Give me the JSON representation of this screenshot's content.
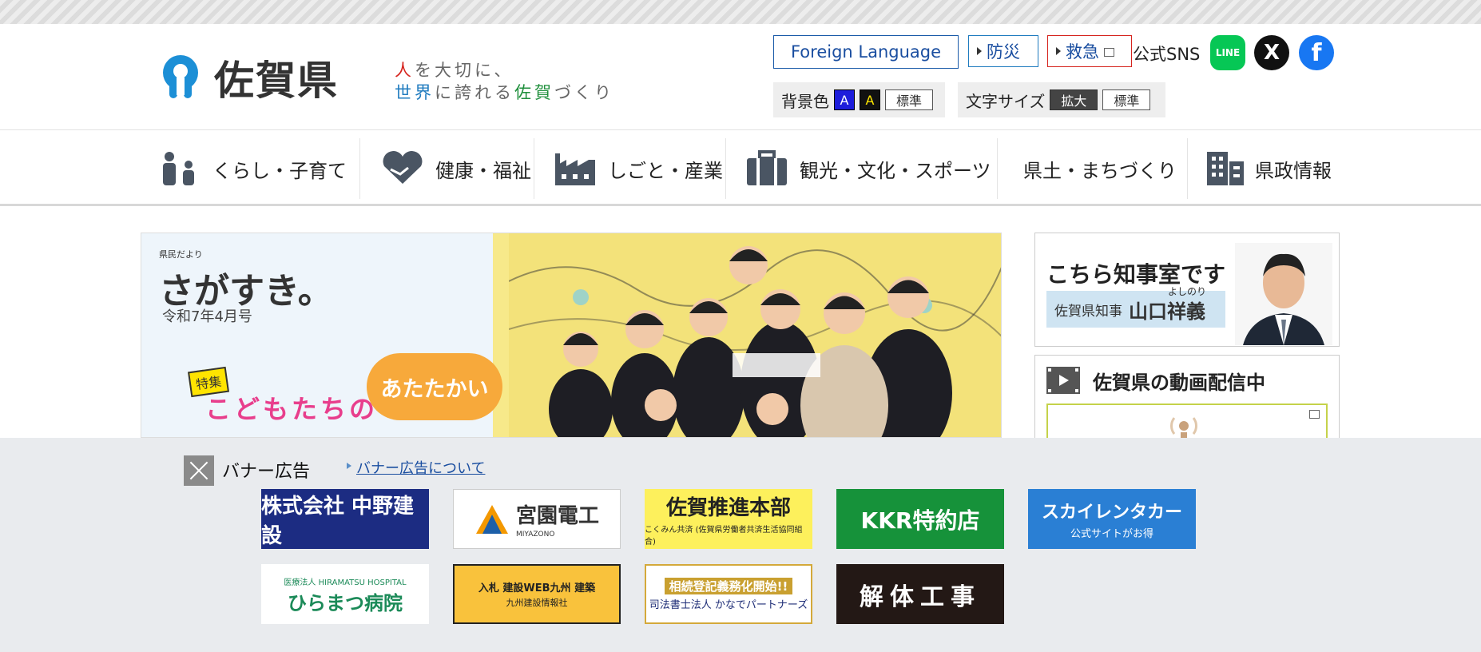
{
  "header": {
    "logo_text": "佐賀県",
    "slogan_line1_a": "人",
    "slogan_line1_b": "を大切に、",
    "slogan_line2_a": "世界",
    "slogan_line2_b": "に誇れる",
    "slogan_line2_c": "佐賀",
    "slogan_line2_d": "づくり",
    "foreign_language": "Foreign Language",
    "bousai": "防災",
    "kyukyu": "救急",
    "sns_label": "公式SNS",
    "sns_line": "LINE",
    "sns_x": "X",
    "sns_fb": "f",
    "bg_color_label": "背景色",
    "bg_blue": "A",
    "bg_black": "A",
    "bg_standard": "標準",
    "font_size_label": "文字サイズ",
    "font_enlarge": "拡大",
    "font_standard": "標準"
  },
  "nav": {
    "items": [
      {
        "label": "くらし・子育て",
        "icon": "family-icon"
      },
      {
        "label": "健康・福祉",
        "icon": "heart-hands-icon"
      },
      {
        "label": "しごと・産業",
        "icon": "factory-icon"
      },
      {
        "label": "観光・文化・スポーツ",
        "icon": "suitcase-icon"
      },
      {
        "label": "県土・まちづくり",
        "icon": ""
      },
      {
        "label": "県政情報",
        "icon": "building-icon"
      }
    ]
  },
  "hero": {
    "small_label": "県民だより",
    "title": "さがすき。",
    "title_sub": "が",
    "issue": "令和7年4月号",
    "tag": "特集",
    "headline": "こどもたちの",
    "cloud_text": "あたたかい"
  },
  "governor": {
    "title": "こちら知事室です",
    "role": "佐賀県知事",
    "name": "山口祥義",
    "ruby": "よしのり"
  },
  "video": {
    "title": "佐賀県の動画配信中"
  },
  "ads": {
    "title": "バナー広告",
    "about": "バナー広告について",
    "banners": [
      {
        "main": "株式会社 中野建設"
      },
      {
        "main": "宮園電工",
        "sub": "MIYAZONO"
      },
      {
        "main": "佐賀推進本部",
        "sub": "こくみん共済 (佐賀県労働者共済生活協同組合)"
      },
      {
        "main": "KKR特約店"
      },
      {
        "main": "スカイレンタカー",
        "sub": "公式サイトがお得"
      },
      {
        "main": "ひらまつ病院",
        "sub": "医療法人 HIRAMATSU HOSPITAL"
      },
      {
        "main": "入札 建設WEB九州 建築",
        "sub": "九州建設情報社"
      },
      {
        "main": "相続登記義務化開始!!",
        "sub": "司法書士法人 かなでパートナーズ"
      },
      {
        "main": "解体工事"
      }
    ]
  },
  "colors": {
    "brand_blue": "#1f7bbf",
    "accent_red": "#d6241e",
    "ad_bg": "#e9ebee"
  }
}
